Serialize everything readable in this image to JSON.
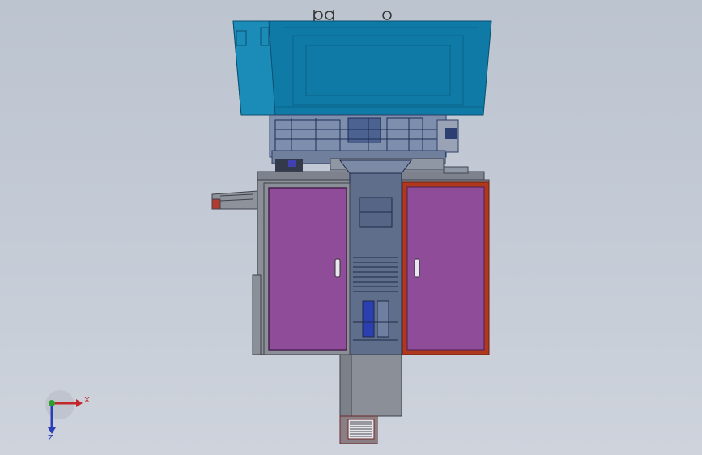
{
  "triad": {
    "x_label": "X",
    "z_label": "Z"
  },
  "colors": {
    "background_top": "#bcc4d0",
    "background_bottom": "#ced3dc",
    "hopper_teal": "#0f7aa6",
    "cabinet_door_purple": "#8f4c98",
    "selected_door_border": "#b0381f",
    "frame_gray": "#8b8f98",
    "x_axis": "#c0282a",
    "z_axis": "#2a3fb5",
    "y_origin": "#2f9e2f"
  },
  "icons": [
    "triad-x-arrow-icon",
    "triad-z-arrow-icon",
    "triad-origin-icon",
    "door-handle-icon"
  ]
}
